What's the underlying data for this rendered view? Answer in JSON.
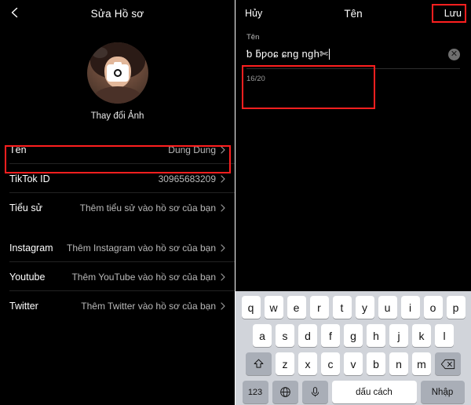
{
  "left": {
    "nav": {
      "back_icon": "chevron-left-icon",
      "title": "Sửa Hồ sơ"
    },
    "avatar": {
      "caption": "Thay đổi Ảnh",
      "camera_icon": "camera-icon"
    },
    "rows": [
      {
        "label": "Tên",
        "value": "Dung Dung",
        "chevron": "chevron-right-icon",
        "highlighted": true
      },
      {
        "label": "TikTok ID",
        "value": "30965683209",
        "chevron": "chevron-right-icon",
        "highlighted": false
      },
      {
        "label": "Tiểu sử",
        "value": "Thêm tiểu sử vào hồ sơ của bạn",
        "chevron": "chevron-right-icon",
        "highlighted": false
      },
      {
        "label": "Instagram",
        "value": "Thêm Instagram vào hồ sơ của bạn",
        "chevron": "chevron-right-icon",
        "highlighted": false
      },
      {
        "label": "Youtube",
        "value": "Thêm YouTube vào hồ sơ của bạn",
        "chevron": "chevron-right-icon",
        "highlighted": false
      },
      {
        "label": "Twitter",
        "value": "Thêm Twitter vào hồ sơ của bạn",
        "chevron": "chevron-right-icon",
        "highlighted": false
      }
    ]
  },
  "right": {
    "nav": {
      "cancel_label": "Hủy",
      "title": "Tên",
      "save_label": "Lưu"
    },
    "field": {
      "label": "Tên",
      "value": "ƅ ƃƿoɕ ɕnɡ ngh✄",
      "placeholder": "Tên",
      "clear_icon": "clear-circle-icon",
      "counter": "16/20"
    },
    "keyboard": {
      "row1": [
        "q",
        "w",
        "e",
        "r",
        "t",
        "y",
        "u",
        "i",
        "o",
        "p"
      ],
      "row2": [
        "a",
        "s",
        "d",
        "f",
        "g",
        "h",
        "j",
        "k",
        "l"
      ],
      "row3": [
        "z",
        "x",
        "c",
        "v",
        "b",
        "n",
        "m"
      ],
      "shift_icon": "shift-icon",
      "backspace_icon": "backspace-icon",
      "numbers_label": "123",
      "globe_icon": "globe-icon",
      "mic_icon": "microphone-icon",
      "space_label": "dấu cách",
      "enter_label": "Nhập"
    }
  },
  "colors": {
    "highlight": "#ff1f1f",
    "background": "#000000",
    "keyboard_bg": "#d1d4da",
    "key_bg": "#ffffff",
    "key_alt_bg": "#a9aeb7"
  }
}
